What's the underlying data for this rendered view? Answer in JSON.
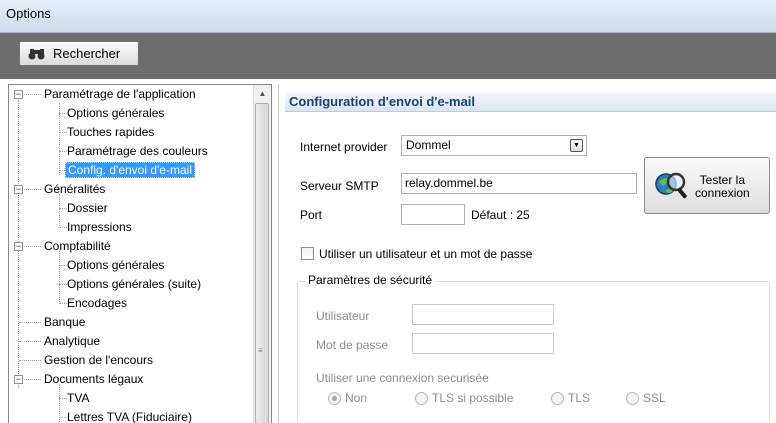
{
  "window": {
    "title": "Options"
  },
  "toolbar": {
    "search_label": "Rechercher",
    "search_icon": "binoculars-icon"
  },
  "tree": {
    "items": [
      {
        "label": "Paramétrage de l'application",
        "level": 0,
        "expanded": true
      },
      {
        "label": "Options générales",
        "level": 1
      },
      {
        "label": "Touches rapides",
        "level": 1
      },
      {
        "label": "Paramétrage des couleurs",
        "level": 1
      },
      {
        "label": "Config. d'envoi d'e-mail",
        "level": 1,
        "selected": true
      },
      {
        "label": "Généralités",
        "level": 0,
        "expanded": true
      },
      {
        "label": "Dossier",
        "level": 1
      },
      {
        "label": "Impressions",
        "level": 1
      },
      {
        "label": "Comptabilité",
        "level": 0,
        "expanded": true
      },
      {
        "label": "Options générales",
        "level": 1
      },
      {
        "label": "Options générales (suite)",
        "level": 1
      },
      {
        "label": "Encodages",
        "level": 1
      },
      {
        "label": "Banque",
        "level": 0
      },
      {
        "label": "Analytique",
        "level": 0
      },
      {
        "label": "Gestion de l'encours",
        "level": 0
      },
      {
        "label": "Documents légaux",
        "level": 0,
        "expanded": true
      },
      {
        "label": "TVA",
        "level": 1
      },
      {
        "label": "Lettres TVA (Fiduciaire)",
        "level": 1
      }
    ]
  },
  "email_config": {
    "title": "Configuration d'envoi d'e-mail",
    "provider_label": "Internet provider",
    "provider_value": "Dommel",
    "smtp_label": "Serveur SMTP",
    "smtp_value": "relay.dommel.be",
    "port_label": "Port",
    "port_value": "",
    "port_default": "Défaut : 25",
    "test_button_line1": "Tester la",
    "test_button_line2": "connexion",
    "use_credentials_label": "Utiliser un utilisateur et un mot de passe",
    "use_credentials_checked": false,
    "security": {
      "legend": "Paramètres de sécurité",
      "user_label": "Utilisateur",
      "user_value": "",
      "password_label": "Mot de passe",
      "password_value": "",
      "secure_label": "Utiliser une connexion securisée",
      "options": [
        "Non",
        "TLS si possible",
        "TLS",
        "SSL"
      ],
      "selected": "Non"
    }
  },
  "colors": {
    "selection": "#3399ff",
    "section_title": "#1f3f6f",
    "toolbar": "#6d6d6d"
  }
}
